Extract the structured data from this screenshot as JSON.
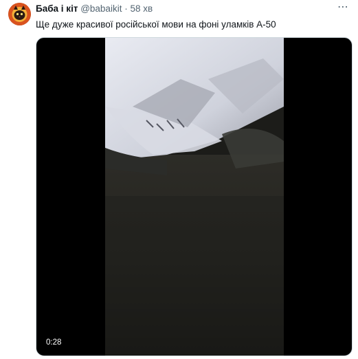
{
  "author": {
    "display_name": "Баба і кіт",
    "handle": "@babaikit",
    "separator": "·",
    "time": "58 хв",
    "avatar_icon": "cat-avatar-icon"
  },
  "more_icon": "more-options-icon",
  "tweet": {
    "text": "Ще дуже красивої російської мови на фоні уламків А-50"
  },
  "media": {
    "type": "video",
    "duration": "0:28"
  },
  "colors": {
    "text_primary": "#0f1419",
    "text_secondary": "#536471",
    "media_background": "#000000"
  }
}
